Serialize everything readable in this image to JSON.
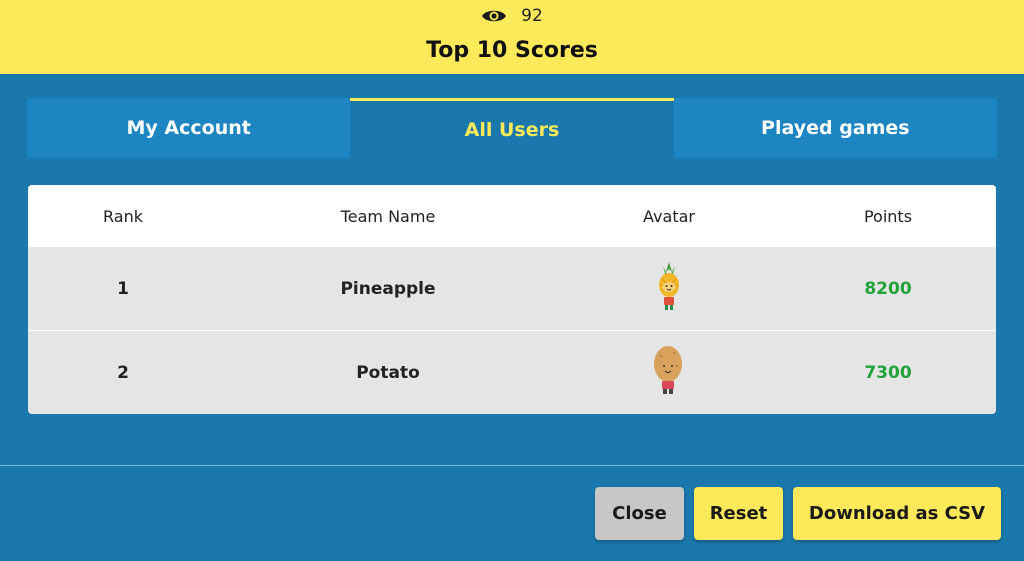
{
  "header": {
    "view_count": "92",
    "eye_icon": "eye-icon",
    "title": "Top 10 Scores"
  },
  "tabs": [
    {
      "label": "My Account",
      "active": false
    },
    {
      "label": "All Users",
      "active": true
    },
    {
      "label": "Played games",
      "active": false
    }
  ],
  "table": {
    "columns": [
      "Rank",
      "Team Name",
      "Avatar",
      "Points"
    ],
    "rows": [
      {
        "rank": "1",
        "team": "Pineapple",
        "avatar": "pineapple-avatar-icon",
        "points": "8200"
      },
      {
        "rank": "2",
        "team": "Potato",
        "avatar": "potato-avatar-icon",
        "points": "7300"
      }
    ]
  },
  "buttons": {
    "close": "Close",
    "reset": "Reset",
    "csv": "Download as CSV"
  },
  "colors": {
    "brand_yellow": "#fde95a",
    "background_blue": "#1a78ad",
    "points_green": "#21a339"
  }
}
